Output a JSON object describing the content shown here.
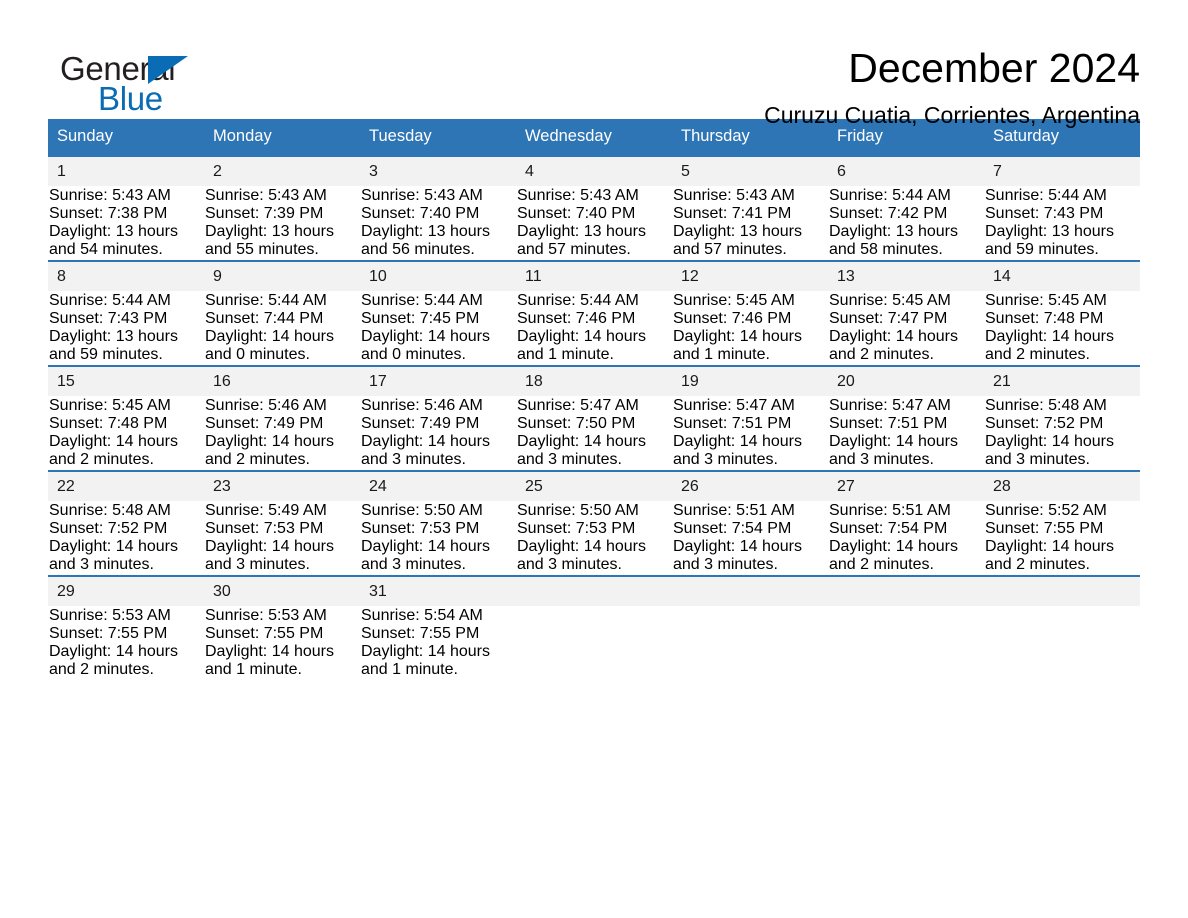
{
  "brand": {
    "name_part1": "General",
    "name_part2": "Blue",
    "accent_color": "#0a6cb4"
  },
  "header": {
    "month_title": "December 2024",
    "location": "Curuzu Cuatia, Corrientes, Argentina",
    "header_bar_color": "#2e75b6",
    "daynum_band_color": "#f2f2f2"
  },
  "calendar": {
    "weekday_headers": [
      "Sunday",
      "Monday",
      "Tuesday",
      "Wednesday",
      "Thursday",
      "Friday",
      "Saturday"
    ],
    "weeks": [
      [
        {
          "day": "1",
          "sunrise": "Sunrise: 5:43 AM",
          "sunset": "Sunset: 7:38 PM",
          "daylight_line1": "Daylight: 13 hours",
          "daylight_line2": "and 54 minutes."
        },
        {
          "day": "2",
          "sunrise": "Sunrise: 5:43 AM",
          "sunset": "Sunset: 7:39 PM",
          "daylight_line1": "Daylight: 13 hours",
          "daylight_line2": "and 55 minutes."
        },
        {
          "day": "3",
          "sunrise": "Sunrise: 5:43 AM",
          "sunset": "Sunset: 7:40 PM",
          "daylight_line1": "Daylight: 13 hours",
          "daylight_line2": "and 56 minutes."
        },
        {
          "day": "4",
          "sunrise": "Sunrise: 5:43 AM",
          "sunset": "Sunset: 7:40 PM",
          "daylight_line1": "Daylight: 13 hours",
          "daylight_line2": "and 57 minutes."
        },
        {
          "day": "5",
          "sunrise": "Sunrise: 5:43 AM",
          "sunset": "Sunset: 7:41 PM",
          "daylight_line1": "Daylight: 13 hours",
          "daylight_line2": "and 57 minutes."
        },
        {
          "day": "6",
          "sunrise": "Sunrise: 5:44 AM",
          "sunset": "Sunset: 7:42 PM",
          "daylight_line1": "Daylight: 13 hours",
          "daylight_line2": "and 58 minutes."
        },
        {
          "day": "7",
          "sunrise": "Sunrise: 5:44 AM",
          "sunset": "Sunset: 7:43 PM",
          "daylight_line1": "Daylight: 13 hours",
          "daylight_line2": "and 59 minutes."
        }
      ],
      [
        {
          "day": "8",
          "sunrise": "Sunrise: 5:44 AM",
          "sunset": "Sunset: 7:43 PM",
          "daylight_line1": "Daylight: 13 hours",
          "daylight_line2": "and 59 minutes."
        },
        {
          "day": "9",
          "sunrise": "Sunrise: 5:44 AM",
          "sunset": "Sunset: 7:44 PM",
          "daylight_line1": "Daylight: 14 hours",
          "daylight_line2": "and 0 minutes."
        },
        {
          "day": "10",
          "sunrise": "Sunrise: 5:44 AM",
          "sunset": "Sunset: 7:45 PM",
          "daylight_line1": "Daylight: 14 hours",
          "daylight_line2": "and 0 minutes."
        },
        {
          "day": "11",
          "sunrise": "Sunrise: 5:44 AM",
          "sunset": "Sunset: 7:46 PM",
          "daylight_line1": "Daylight: 14 hours",
          "daylight_line2": "and 1 minute."
        },
        {
          "day": "12",
          "sunrise": "Sunrise: 5:45 AM",
          "sunset": "Sunset: 7:46 PM",
          "daylight_line1": "Daylight: 14 hours",
          "daylight_line2": "and 1 minute."
        },
        {
          "day": "13",
          "sunrise": "Sunrise: 5:45 AM",
          "sunset": "Sunset: 7:47 PM",
          "daylight_line1": "Daylight: 14 hours",
          "daylight_line2": "and 2 minutes."
        },
        {
          "day": "14",
          "sunrise": "Sunrise: 5:45 AM",
          "sunset": "Sunset: 7:48 PM",
          "daylight_line1": "Daylight: 14 hours",
          "daylight_line2": "and 2 minutes."
        }
      ],
      [
        {
          "day": "15",
          "sunrise": "Sunrise: 5:45 AM",
          "sunset": "Sunset: 7:48 PM",
          "daylight_line1": "Daylight: 14 hours",
          "daylight_line2": "and 2 minutes."
        },
        {
          "day": "16",
          "sunrise": "Sunrise: 5:46 AM",
          "sunset": "Sunset: 7:49 PM",
          "daylight_line1": "Daylight: 14 hours",
          "daylight_line2": "and 2 minutes."
        },
        {
          "day": "17",
          "sunrise": "Sunrise: 5:46 AM",
          "sunset": "Sunset: 7:49 PM",
          "daylight_line1": "Daylight: 14 hours",
          "daylight_line2": "and 3 minutes."
        },
        {
          "day": "18",
          "sunrise": "Sunrise: 5:47 AM",
          "sunset": "Sunset: 7:50 PM",
          "daylight_line1": "Daylight: 14 hours",
          "daylight_line2": "and 3 minutes."
        },
        {
          "day": "19",
          "sunrise": "Sunrise: 5:47 AM",
          "sunset": "Sunset: 7:51 PM",
          "daylight_line1": "Daylight: 14 hours",
          "daylight_line2": "and 3 minutes."
        },
        {
          "day": "20",
          "sunrise": "Sunrise: 5:47 AM",
          "sunset": "Sunset: 7:51 PM",
          "daylight_line1": "Daylight: 14 hours",
          "daylight_line2": "and 3 minutes."
        },
        {
          "day": "21",
          "sunrise": "Sunrise: 5:48 AM",
          "sunset": "Sunset: 7:52 PM",
          "daylight_line1": "Daylight: 14 hours",
          "daylight_line2": "and 3 minutes."
        }
      ],
      [
        {
          "day": "22",
          "sunrise": "Sunrise: 5:48 AM",
          "sunset": "Sunset: 7:52 PM",
          "daylight_line1": "Daylight: 14 hours",
          "daylight_line2": "and 3 minutes."
        },
        {
          "day": "23",
          "sunrise": "Sunrise: 5:49 AM",
          "sunset": "Sunset: 7:53 PM",
          "daylight_line1": "Daylight: 14 hours",
          "daylight_line2": "and 3 minutes."
        },
        {
          "day": "24",
          "sunrise": "Sunrise: 5:50 AM",
          "sunset": "Sunset: 7:53 PM",
          "daylight_line1": "Daylight: 14 hours",
          "daylight_line2": "and 3 minutes."
        },
        {
          "day": "25",
          "sunrise": "Sunrise: 5:50 AM",
          "sunset": "Sunset: 7:53 PM",
          "daylight_line1": "Daylight: 14 hours",
          "daylight_line2": "and 3 minutes."
        },
        {
          "day": "26",
          "sunrise": "Sunrise: 5:51 AM",
          "sunset": "Sunset: 7:54 PM",
          "daylight_line1": "Daylight: 14 hours",
          "daylight_line2": "and 3 minutes."
        },
        {
          "day": "27",
          "sunrise": "Sunrise: 5:51 AM",
          "sunset": "Sunset: 7:54 PM",
          "daylight_line1": "Daylight: 14 hours",
          "daylight_line2": "and 2 minutes."
        },
        {
          "day": "28",
          "sunrise": "Sunrise: 5:52 AM",
          "sunset": "Sunset: 7:55 PM",
          "daylight_line1": "Daylight: 14 hours",
          "daylight_line2": "and 2 minutes."
        }
      ],
      [
        {
          "day": "29",
          "sunrise": "Sunrise: 5:53 AM",
          "sunset": "Sunset: 7:55 PM",
          "daylight_line1": "Daylight: 14 hours",
          "daylight_line2": "and 2 minutes."
        },
        {
          "day": "30",
          "sunrise": "Sunrise: 5:53 AM",
          "sunset": "Sunset: 7:55 PM",
          "daylight_line1": "Daylight: 14 hours",
          "daylight_line2": "and 1 minute."
        },
        {
          "day": "31",
          "sunrise": "Sunrise: 5:54 AM",
          "sunset": "Sunset: 7:55 PM",
          "daylight_line1": "Daylight: 14 hours",
          "daylight_line2": "and 1 minute."
        },
        {
          "day": "",
          "sunrise": "",
          "sunset": "",
          "daylight_line1": "",
          "daylight_line2": ""
        },
        {
          "day": "",
          "sunrise": "",
          "sunset": "",
          "daylight_line1": "",
          "daylight_line2": ""
        },
        {
          "day": "",
          "sunrise": "",
          "sunset": "",
          "daylight_line1": "",
          "daylight_line2": ""
        },
        {
          "day": "",
          "sunrise": "",
          "sunset": "",
          "daylight_line1": "",
          "daylight_line2": ""
        }
      ]
    ]
  }
}
